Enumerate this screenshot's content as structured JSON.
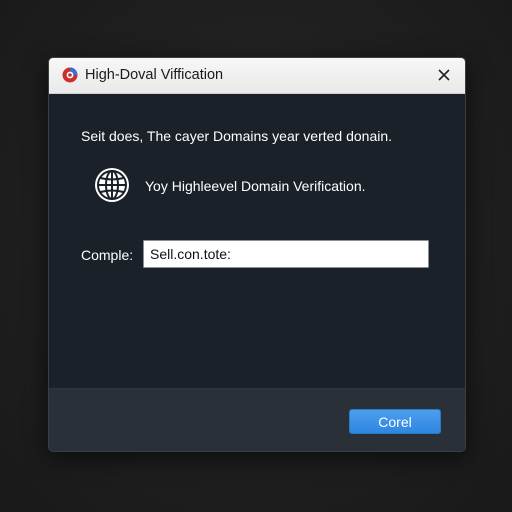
{
  "dialog": {
    "title": "High-Doval Viffication",
    "message": "Seit does, The cayer Domains year verted donain.",
    "info_text": "Yoy Highleevel Domain Verification.",
    "field_label": "Comple:",
    "field_value": "Sell.con.tote:",
    "primary_button_label": "Corel"
  },
  "icons": {
    "app": "app-logo-icon",
    "close": "close-icon",
    "info": "globe-icon"
  },
  "colors": {
    "accent": "#3b8fe6",
    "dialog_bg": "#1b2129",
    "footer_bg": "#2a3038",
    "titlebar_bg": "#eeeeee"
  }
}
